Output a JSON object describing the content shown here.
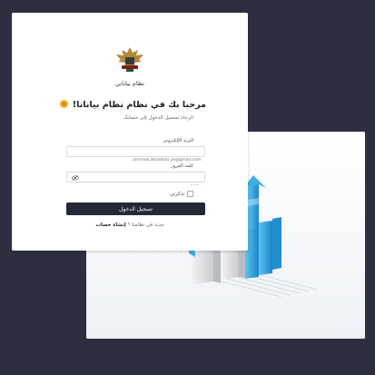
{
  "logo": {
    "caption": "نظام بياناتي"
  },
  "welcome": {
    "title": "مرحبا بك في نظام نظام بياناتا!",
    "subtitle": "الرجاء تسجيل الدخول إلى حسابك"
  },
  "form": {
    "email_label": "البريد الإلكتروني",
    "email_placeholder": "ammaw.alhaddad.ye@gmail.com",
    "password_label": "كلمة المرور",
    "password_placeholder": "········",
    "remember_label": "تذكرني",
    "submit_label": "تسجيل الدخول"
  },
  "register": {
    "prompt": "جديد في نظامنا ؟",
    "link": "إنشاء حساب"
  },
  "colors": {
    "background": "#2d2f40",
    "button": "#262838",
    "accent_blue": "#2ea6e0"
  }
}
